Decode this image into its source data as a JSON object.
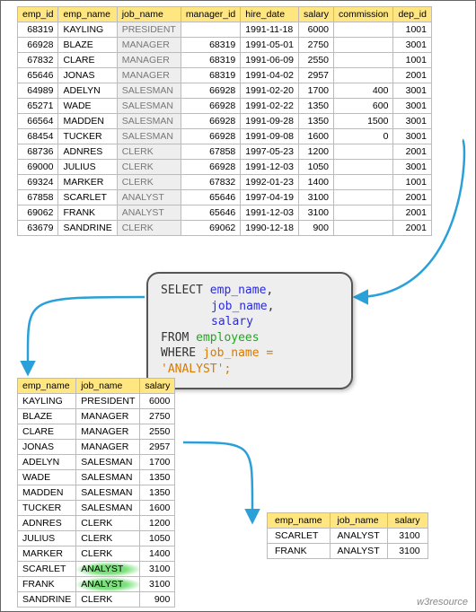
{
  "chart_data": {
    "type": "table",
    "source_table": {
      "columns": [
        "emp_id",
        "emp_name",
        "job_name",
        "manager_id",
        "hire_date",
        "salary",
        "commission",
        "dep_id"
      ],
      "rows": [
        {
          "emp_id": 68319,
          "emp_name": "KAYLING",
          "job_name": "PRESIDENT",
          "manager_id": "",
          "hire_date": "1991-11-18",
          "salary": 6000,
          "commission": "",
          "dep_id": 1001
        },
        {
          "emp_id": 66928,
          "emp_name": "BLAZE",
          "job_name": "MANAGER",
          "manager_id": 68319,
          "hire_date": "1991-05-01",
          "salary": 2750,
          "commission": "",
          "dep_id": 3001
        },
        {
          "emp_id": 67832,
          "emp_name": "CLARE",
          "job_name": "MANAGER",
          "manager_id": 68319,
          "hire_date": "1991-06-09",
          "salary": 2550,
          "commission": "",
          "dep_id": 1001
        },
        {
          "emp_id": 65646,
          "emp_name": "JONAS",
          "job_name": "MANAGER",
          "manager_id": 68319,
          "hire_date": "1991-04-02",
          "salary": 2957,
          "commission": "",
          "dep_id": 2001
        },
        {
          "emp_id": 64989,
          "emp_name": "ADELYN",
          "job_name": "SALESMAN",
          "manager_id": 66928,
          "hire_date": "1991-02-20",
          "salary": 1700,
          "commission": 400,
          "dep_id": 3001
        },
        {
          "emp_id": 65271,
          "emp_name": "WADE",
          "job_name": "SALESMAN",
          "manager_id": 66928,
          "hire_date": "1991-02-22",
          "salary": 1350,
          "commission": 600,
          "dep_id": 3001
        },
        {
          "emp_id": 66564,
          "emp_name": "MADDEN",
          "job_name": "SALESMAN",
          "manager_id": 66928,
          "hire_date": "1991-09-28",
          "salary": 1350,
          "commission": 1500,
          "dep_id": 3001
        },
        {
          "emp_id": 68454,
          "emp_name": "TUCKER",
          "job_name": "SALESMAN",
          "manager_id": 66928,
          "hire_date": "1991-09-08",
          "salary": 1600,
          "commission": 0,
          "dep_id": 3001
        },
        {
          "emp_id": 68736,
          "emp_name": "ADNRES",
          "job_name": "CLERK",
          "manager_id": 67858,
          "hire_date": "1997-05-23",
          "salary": 1200,
          "commission": "",
          "dep_id": 2001
        },
        {
          "emp_id": 69000,
          "emp_name": "JULIUS",
          "job_name": "CLERK",
          "manager_id": 66928,
          "hire_date": "1991-12-03",
          "salary": 1050,
          "commission": "",
          "dep_id": 3001
        },
        {
          "emp_id": 69324,
          "emp_name": "MARKER",
          "job_name": "CLERK",
          "manager_id": 67832,
          "hire_date": "1992-01-23",
          "salary": 1400,
          "commission": "",
          "dep_id": 1001
        },
        {
          "emp_id": 67858,
          "emp_name": "SCARLET",
          "job_name": "ANALYST",
          "manager_id": 65646,
          "hire_date": "1997-04-19",
          "salary": 3100,
          "commission": "",
          "dep_id": 2001
        },
        {
          "emp_id": 69062,
          "emp_name": "FRANK",
          "job_name": "ANALYST",
          "manager_id": 65646,
          "hire_date": "1991-12-03",
          "salary": 3100,
          "commission": "",
          "dep_id": 2001
        },
        {
          "emp_id": 63679,
          "emp_name": "SANDRINE",
          "job_name": "CLERK",
          "manager_id": 69062,
          "hire_date": "1990-12-18",
          "salary": 900,
          "commission": "",
          "dep_id": 2001
        }
      ]
    },
    "projection_table": {
      "columns": [
        "emp_name",
        "job_name",
        "salary"
      ],
      "highlight_job": "ANALYST",
      "rows": [
        {
          "emp_name": "KAYLING",
          "job_name": "PRESIDENT",
          "salary": 6000
        },
        {
          "emp_name": "BLAZE",
          "job_name": "MANAGER",
          "salary": 2750
        },
        {
          "emp_name": "CLARE",
          "job_name": "MANAGER",
          "salary": 2550
        },
        {
          "emp_name": "JONAS",
          "job_name": "MANAGER",
          "salary": 2957
        },
        {
          "emp_name": "ADELYN",
          "job_name": "SALESMAN",
          "salary": 1700
        },
        {
          "emp_name": "WADE",
          "job_name": "SALESMAN",
          "salary": 1350
        },
        {
          "emp_name": "MADDEN",
          "job_name": "SALESMAN",
          "salary": 1350
        },
        {
          "emp_name": "TUCKER",
          "job_name": "SALESMAN",
          "salary": 1600
        },
        {
          "emp_name": "ADNRES",
          "job_name": "CLERK",
          "salary": 1200
        },
        {
          "emp_name": "JULIUS",
          "job_name": "CLERK",
          "salary": 1050
        },
        {
          "emp_name": "MARKER",
          "job_name": "CLERK",
          "salary": 1400
        },
        {
          "emp_name": "SCARLET",
          "job_name": "ANALYST",
          "salary": 3100
        },
        {
          "emp_name": "FRANK",
          "job_name": "ANALYST",
          "salary": 3100
        },
        {
          "emp_name": "SANDRINE",
          "job_name": "CLERK",
          "salary": 900
        }
      ]
    },
    "result_table": {
      "columns": [
        "emp_name",
        "job_name",
        "salary"
      ],
      "rows": [
        {
          "emp_name": "SCARLET",
          "job_name": "ANALYST",
          "salary": 3100
        },
        {
          "emp_name": "FRANK",
          "job_name": "ANALYST",
          "salary": 3100
        }
      ]
    }
  },
  "sql": {
    "select_kw": "SELECT ",
    "col1": "emp_name",
    "comma1": ",",
    "col2": "job_name",
    "comma2": ",",
    "col3": "salary",
    "from_kw": "FROM ",
    "table": "employees",
    "where_kw": "WHERE ",
    "predicate": "job_name = 'ANALYST';"
  },
  "footer": "w3resource"
}
